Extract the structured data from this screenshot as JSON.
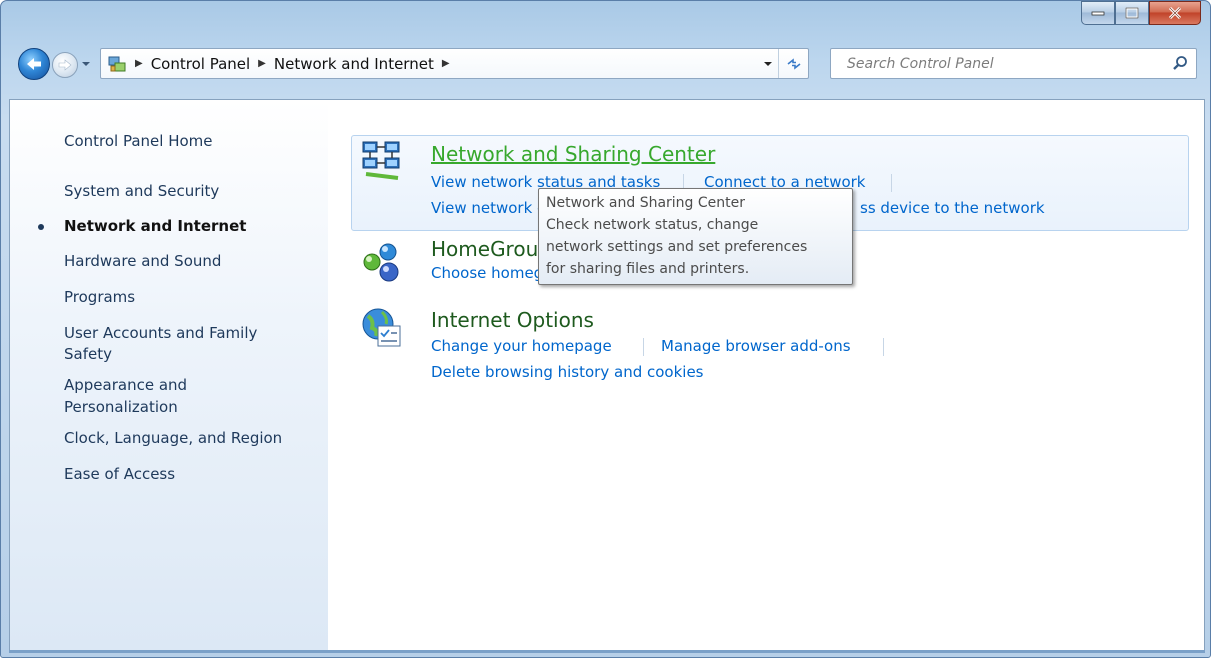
{
  "window": {
    "minimize_icon": "minimize-icon",
    "maximize_icon": "maximize-icon",
    "close_icon": "close-icon"
  },
  "navigation": {
    "breadcrumbs": [
      "Control Panel",
      "Network and Internet"
    ],
    "search_placeholder": "Search Control Panel"
  },
  "sidebar": {
    "items": [
      {
        "label": "Control Panel Home",
        "active": false
      },
      {
        "label": "System and Security",
        "active": false
      },
      {
        "label": "Network and Internet",
        "active": true
      },
      {
        "label": "Hardware and Sound",
        "active": false
      },
      {
        "label": "Programs",
        "active": false
      },
      {
        "label": "User Accounts and Family",
        "label2": "Safety",
        "active": false
      },
      {
        "label": "Appearance and",
        "label2": "Personalization",
        "active": false
      },
      {
        "label": "Clock, Language, and Region",
        "active": false
      },
      {
        "label": "Ease of Access",
        "active": false
      }
    ]
  },
  "categories": [
    {
      "title": "Network and Sharing Center",
      "tasks": [
        "View network status and tasks",
        "Connect to a network",
        "View network c",
        "ss device to the network"
      ]
    },
    {
      "title": "HomeGrou",
      "tasks": [
        "Choose homeg"
      ]
    },
    {
      "title": "Internet Options",
      "tasks": [
        "Change your homepage",
        "Manage browser add-ons",
        "Delete browsing history and cookies"
      ]
    }
  ],
  "tooltip": {
    "lines": [
      "Network and Sharing Center",
      "Check network status, change",
      "network settings and set preferences",
      "for sharing files and printers."
    ]
  },
  "colors": {
    "link": "#0066cc",
    "hover_title": "#37a82d",
    "title": "#1e5a1e",
    "sidebar_text": "#1e395b"
  }
}
